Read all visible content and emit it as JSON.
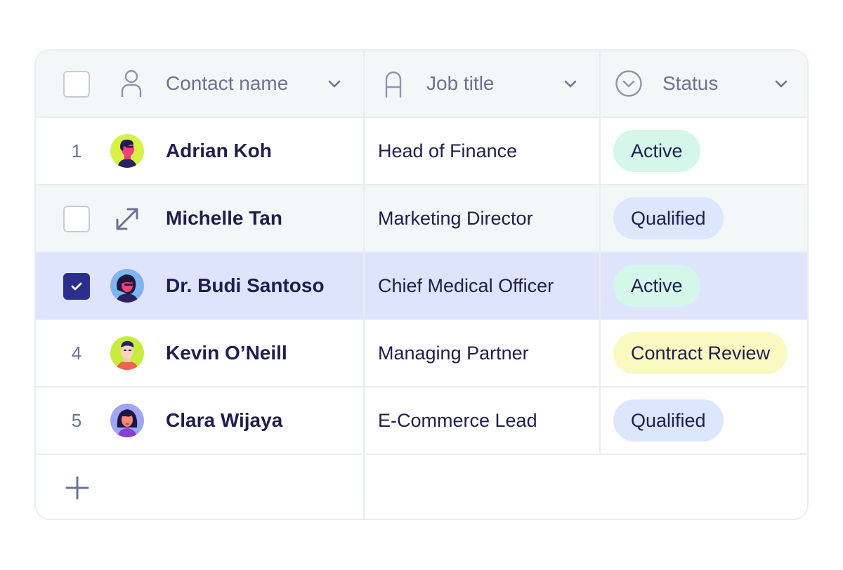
{
  "header": {
    "col1_label": "Contact name",
    "col2_label": "Job title",
    "col3_label": "Status",
    "col1_icon": "person-icon",
    "col2_icon": "text-type-icon",
    "col3_icon": "dropdown-circle-icon"
  },
  "rows": [
    {
      "num": "1",
      "name": "Adrian Koh",
      "job": "Head of Finance",
      "status": "Active",
      "status_color": "#d4f7ea",
      "avatar_bg": "#d8f147",
      "state": "normal"
    },
    {
      "num": "",
      "name": "Michelle Tan",
      "job": "Marketing Director",
      "status": "Qualified",
      "status_color": "#dce6fd",
      "avatar_bg": "",
      "state": "hover"
    },
    {
      "num": "",
      "name": "Dr. Budi Santoso",
      "job": "Chief Medical Officer",
      "status": "Active",
      "status_color": "#d4f7ea",
      "avatar_bg": "#7fb4f0",
      "state": "selected"
    },
    {
      "num": "4",
      "name": "Kevin O’Neill",
      "job": "Managing Partner",
      "status": "Contract Review",
      "status_color": "#fbf9c2",
      "avatar_bg": "#c8ec3e",
      "state": "normal"
    },
    {
      "num": "5",
      "name": "Clara Wijaya",
      "job": "E-Commerce Lead",
      "status": "Qualified",
      "status_color": "#dce6fd",
      "avatar_bg": "#9fa6f4",
      "state": "normal"
    }
  ],
  "colors": {
    "accent": "#2c2e8e",
    "selected_row": "#dfe4fd",
    "header_bg": "#f4f7f7"
  }
}
